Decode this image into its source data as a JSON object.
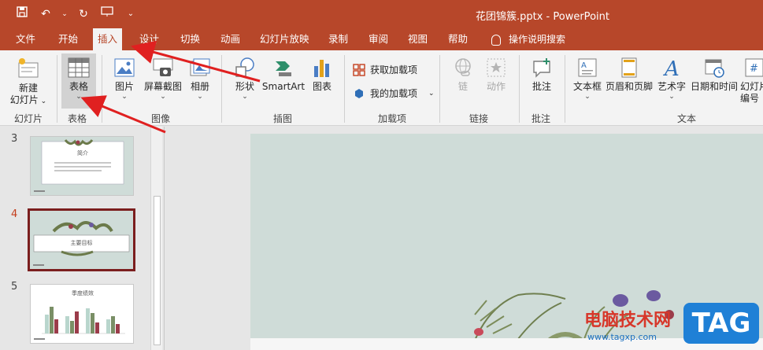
{
  "window": {
    "title": "花团锦簇.pptx  -  PowerPoint"
  },
  "menu_tabs": [
    "文件",
    "开始",
    "插入",
    "设计",
    "切换",
    "动画",
    "幻灯片放映",
    "录制",
    "审阅",
    "视图",
    "帮助"
  ],
  "active_tab": "插入",
  "tell_me": "操作说明搜索",
  "ribbon": {
    "new_slide": [
      "新建",
      "幻灯片"
    ],
    "table": "表格",
    "picture": "图片",
    "screenshot": "屏幕截图",
    "album": "相册",
    "shapes": "形状",
    "smartart": "SmartArt",
    "chart": "图表",
    "get_addins": "获取加载项",
    "my_addins": "我的加载项",
    "link": "链接",
    "action": "动作",
    "comment": "批注",
    "textbox": "文本框",
    "header_footer": "页眉和页脚",
    "wordart": "艺术字",
    "datetime": "日期和时间",
    "slide_number": [
      "幻灯片",
      "编号"
    ],
    "groups": {
      "slides": "幻灯片",
      "tables": "表格",
      "images": "图像",
      "illustrations": "插图",
      "addins": "加载项",
      "links": "链接",
      "comments": "批注",
      "text": "文本"
    }
  },
  "slides": [
    {
      "number": "3",
      "title": "简介"
    },
    {
      "number": "4",
      "title": "主要目标"
    },
    {
      "number": "5",
      "title": "季度绩效"
    }
  ],
  "watermark": {
    "text": "电脑技术网",
    "url": "www.tagxp.com",
    "badge": "TAG"
  },
  "colors": {
    "accent": "#b7472a",
    "slide_bg": "#cfdcd8",
    "arrow": "#e02020"
  }
}
